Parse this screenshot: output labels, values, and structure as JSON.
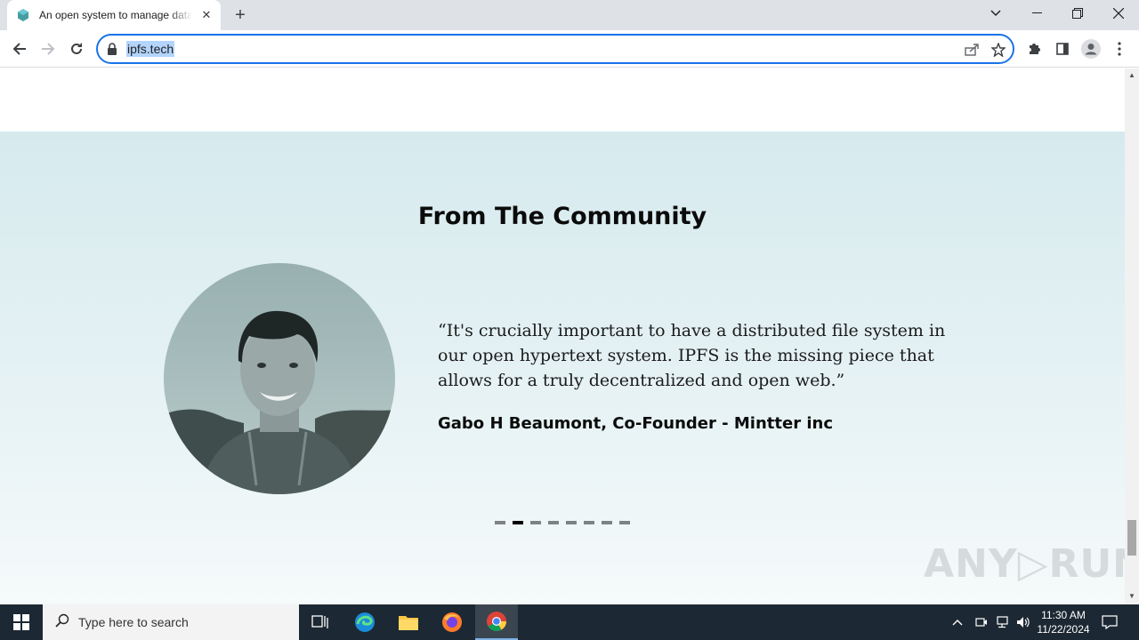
{
  "browser": {
    "tab_title": "An open system to manage data",
    "tab_close": "✕",
    "new_tab": "+",
    "url": "ipfs.tech"
  },
  "page": {
    "heading": "From The Community",
    "quote": "“It's crucially important to have a distributed file system in our open hypertext system. IPFS is the missing piece that allows for a truly decentralized and open web.”",
    "author": "Gabo H Beaumont, Co-Founder - Mintter inc",
    "carousel": {
      "total": 8,
      "active_index": 1
    },
    "watermark": "ANY▷RUN"
  },
  "taskbar": {
    "search_placeholder": "Type here to search",
    "time": "11:30 AM",
    "date": "11/22/2024"
  },
  "colors": {
    "accent": "#1a73e8",
    "section_bg": "#d6eaee",
    "taskbar": "#1c2833"
  }
}
